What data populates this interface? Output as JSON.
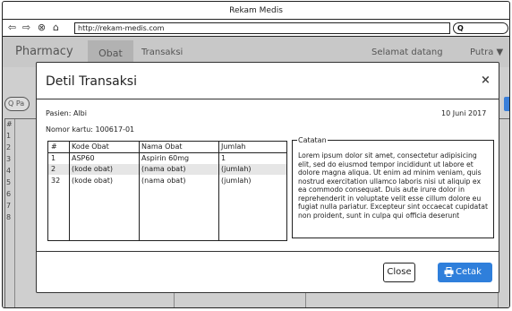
{
  "browser": {
    "title": "Rekam Medis",
    "url": "http://rekam-medis.com",
    "search_placeholder": "Q"
  },
  "app": {
    "brand": "Pharmacy",
    "tabs": [
      {
        "label": "Obat",
        "active": true
      },
      {
        "label": "Transaksi",
        "active": false
      }
    ],
    "welcome": "Selamat datang",
    "user": "Putra ▼",
    "search_prefix": "Q Pa",
    "row_numbers": [
      "#",
      "1",
      "2",
      "3",
      "4",
      "5",
      "6",
      "7",
      "8"
    ]
  },
  "modal": {
    "title": "Detil Transaksi",
    "close_glyph": "×",
    "patient": "Pasien: Albi",
    "card": "Nomor kartu: 100617-01",
    "date": "10 Juni 2017",
    "table": {
      "headers": [
        "#",
        "Kode Obat",
        "Nama Obat",
        "Jumlah"
      ],
      "rows": [
        [
          "1",
          "ASP60",
          "Aspirin 60mg",
          "1"
        ],
        [
          "2",
          "(kode obat)",
          "(nama obat)",
          "(jumlah)"
        ],
        [
          "32",
          "(kode obat)",
          "(nama obat)",
          "(jumlah)"
        ]
      ]
    },
    "notes_label": "Catatan",
    "notes_text": "Lorem ipsum dolor sit amet, consectetur adipisicing elit, sed do eiusmod tempor incididunt ut labore et dolore magna aliqua. Ut enim ad minim veniam, quis nostrud exercitation ullamco laboris nisi ut aliquip ex ea commodo consequat. Duis aute irure dolor in reprehenderit in voluptate velit esse cillum dolore eu fugiat nulla pariatur. Excepteur sint occaecat cupidatat non proident, sunt in culpa qui officia deserunt",
    "close_button": "Close",
    "print_button": "Cetak"
  },
  "colors": {
    "accent": "#2f7fdb",
    "overlay": "#c8c8c8"
  },
  "icons": [
    "back-icon",
    "forward-icon",
    "stop-icon",
    "home-icon",
    "search-icon",
    "close-icon",
    "printer-icon"
  ]
}
